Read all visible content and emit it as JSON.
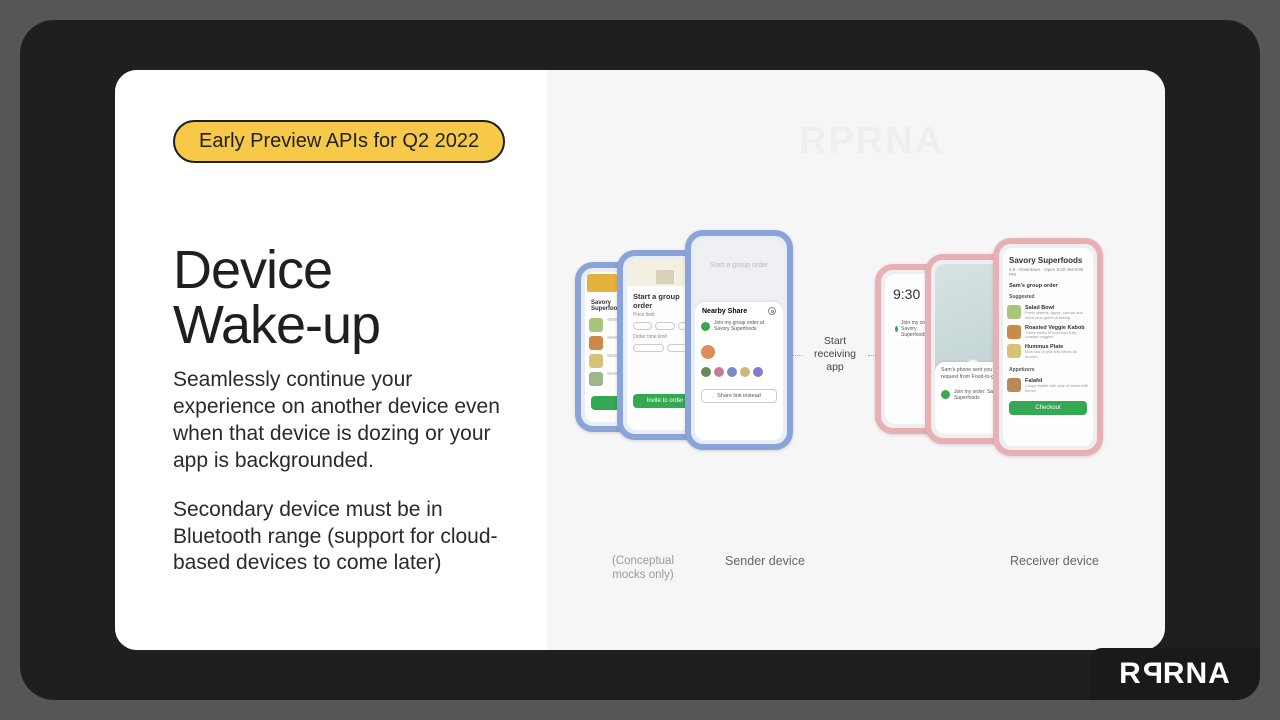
{
  "badge": "Early Preview APIs for Q2 2022",
  "title_l1": "Device",
  "title_l2": "Wake-up",
  "para1": "Seamlessly continue your experience on another device even when that device is dozing or your app is backgrounded.",
  "para2": "Secondary device must be in Bluetooth range (support for cloud-based devices to come later)",
  "connector_l1": "Start",
  "connector_l2": "receiving",
  "connector_l3": "app",
  "caption_mocks": "(Conceptual mocks only)",
  "caption_sender": "Sender device",
  "caption_receiver": "Receiver device",
  "watermark": "RPRNA",
  "logo_text": "R RNA",
  "sender": {
    "mid_title": "Start a group order",
    "front_title_faded": "Start a group order",
    "front_sheet_title": "Nearby Share",
    "front_sheet_sub": "Join my group order at Savory Superfoods",
    "mid_price_label": "Price limit",
    "mid_time_label": "Order time limit",
    "invite_btn": "Invite to order",
    "share_btn": "Share link instead"
  },
  "receiver": {
    "clock": "9:30",
    "notif1": "Join my order at Savory Superfoods",
    "mid_sheet_line": "Sam's phone sent you a request from Food-to-go",
    "mid_sheet_btn": "Join my order: Savory Superfoods",
    "front_title": "Savory Superfoods",
    "front_sub": "4.8 · Downtown · Open 9:30 AM-9:00 PM",
    "front_heading": "Sam's group order",
    "front_suggested": "Suggested",
    "items": [
      {
        "name": "Salad Bowl",
        "desc": "Fresh greens, apple, carrots and more plus green dressing",
        "color": "#a8c57a"
      },
      {
        "name": "Roasted Veggie Kabob",
        "desc": "Three sticks of luxurious fully roasted veggies",
        "color": "#c98a4a"
      },
      {
        "name": "Hummus Plate",
        "desc": "With lots of pita and olives all around",
        "color": "#d8c27a"
      }
    ],
    "front_appetizers": "Appetizers",
    "app_item": {
      "name": "Falafel",
      "desc": "Crispy falafel with side of tahini with lemon",
      "color": "#b88a5a"
    },
    "checkout_btn": "Checkout"
  }
}
